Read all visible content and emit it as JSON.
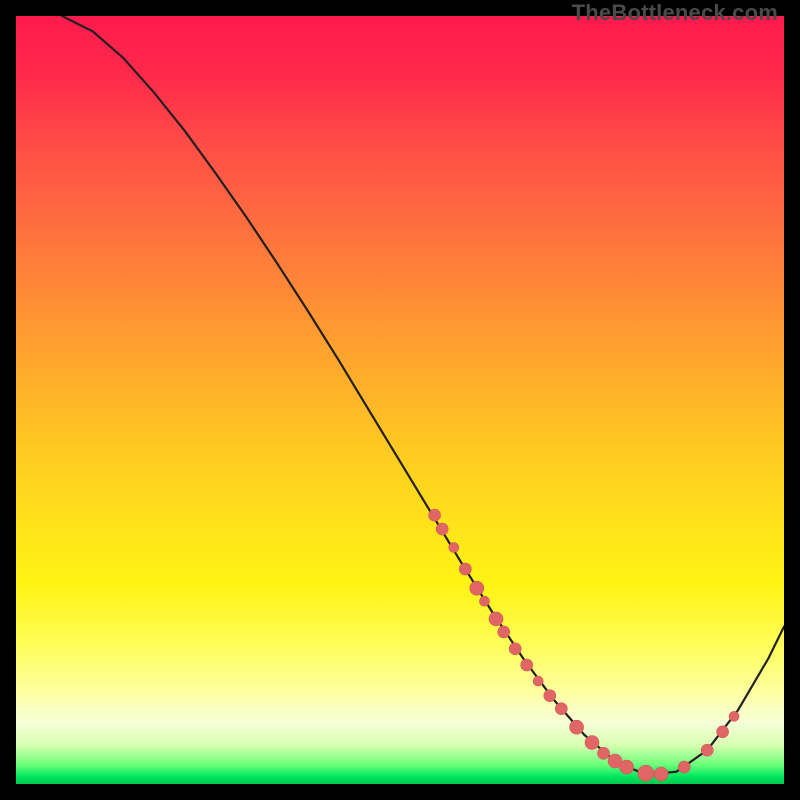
{
  "watermark": "TheBottleneck.com",
  "colors": {
    "background": "#000000",
    "curve_stroke": "#231f20",
    "marker_fill": "#e06666",
    "marker_stroke": "#d35454"
  },
  "chart_data": {
    "type": "line",
    "title": "",
    "xlabel": "",
    "ylabel": "",
    "xlim": [
      0,
      100
    ],
    "ylim": [
      0,
      100
    ],
    "grid": false,
    "legend": false,
    "series": [
      {
        "name": "bottleneck-curve",
        "x": [
          6,
          10,
          14,
          18,
          22,
          26,
          30,
          34,
          38,
          42,
          46,
          50,
          54,
          58,
          62,
          66,
          70,
          74,
          78,
          82,
          86,
          90,
          94,
          98,
          100
        ],
        "y": [
          100,
          98,
          94.5,
          90,
          85,
          79.5,
          73.8,
          67.8,
          61.6,
          55.2,
          48.6,
          42,
          35.4,
          28.8,
          22.4,
          16.4,
          11,
          6.4,
          3.0,
          1.2,
          1.6,
          4.4,
          9.6,
          16.4,
          20.5
        ]
      }
    ],
    "markers": [
      {
        "x": 54.5,
        "y": 35.0,
        "r": 6
      },
      {
        "x": 55.5,
        "y": 33.2,
        "r": 6
      },
      {
        "x": 57.0,
        "y": 30.8,
        "r": 5
      },
      {
        "x": 58.5,
        "y": 28.0,
        "r": 6
      },
      {
        "x": 60.0,
        "y": 25.5,
        "r": 7
      },
      {
        "x": 61.0,
        "y": 23.8,
        "r": 5
      },
      {
        "x": 62.5,
        "y": 21.5,
        "r": 7
      },
      {
        "x": 63.5,
        "y": 19.8,
        "r": 6
      },
      {
        "x": 65.0,
        "y": 17.6,
        "r": 6
      },
      {
        "x": 66.5,
        "y": 15.5,
        "r": 6
      },
      {
        "x": 68.0,
        "y": 13.4,
        "r": 5
      },
      {
        "x": 69.5,
        "y": 11.5,
        "r": 6
      },
      {
        "x": 71.0,
        "y": 9.8,
        "r": 6
      },
      {
        "x": 73.0,
        "y": 7.4,
        "r": 7
      },
      {
        "x": 75.0,
        "y": 5.4,
        "r": 7
      },
      {
        "x": 76.5,
        "y": 4.0,
        "r": 6
      },
      {
        "x": 78.0,
        "y": 3.0,
        "r": 7
      },
      {
        "x": 79.5,
        "y": 2.2,
        "r": 7
      },
      {
        "x": 82.0,
        "y": 1.4,
        "r": 8
      },
      {
        "x": 84.0,
        "y": 1.3,
        "r": 7
      },
      {
        "x": 87.0,
        "y": 2.2,
        "r": 6
      },
      {
        "x": 90.0,
        "y": 4.4,
        "r": 6
      },
      {
        "x": 92.0,
        "y": 6.8,
        "r": 6
      },
      {
        "x": 93.5,
        "y": 8.8,
        "r": 5
      }
    ]
  }
}
